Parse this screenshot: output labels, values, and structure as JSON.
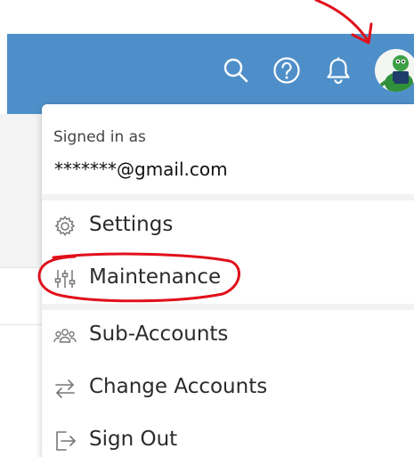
{
  "header": {
    "icons": [
      "search-icon",
      "help-icon",
      "bell-icon",
      "avatar"
    ],
    "background_color": "#4f8fc9"
  },
  "account_menu": {
    "signed_in_label": "Signed in as",
    "email": "*******@gmail.com",
    "items": [
      {
        "label": "Settings",
        "icon": "gear-icon"
      },
      {
        "label": "Maintenance",
        "icon": "sliders-icon"
      },
      {
        "label": "Sub-Accounts",
        "icon": "users-icon"
      },
      {
        "label": "Change Accounts",
        "icon": "swap-arrows-icon"
      },
      {
        "label": "Sign Out",
        "icon": "sign-out-icon"
      }
    ]
  },
  "annotations": {
    "arrow_color": "#e0101a",
    "circle_color": "#e0101a"
  }
}
